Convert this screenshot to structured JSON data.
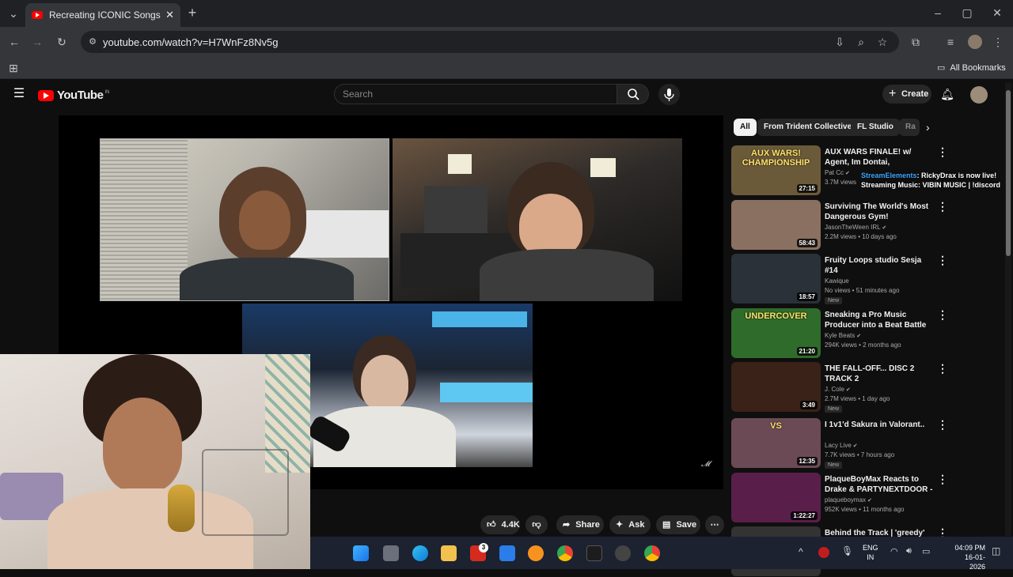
{
  "browser": {
    "tab_title": "Recreating ICONIC Songs With",
    "url": "youtube.com/watch?v=H7WnFz8Nv5g",
    "bookmarks_label": "All Bookmarks"
  },
  "youtube": {
    "logo_text": "YouTube",
    "country_code": "IN",
    "search_placeholder": "Search",
    "create_label": "Create"
  },
  "actions": {
    "likes": "4.4K",
    "share_label": "Share",
    "ask_label": "Ask",
    "save_label": "Save"
  },
  "chips": [
    "All",
    "From Trident Collective",
    "FL Studio",
    "Ra"
  ],
  "overlay_text": {
    "line1_name": "StreamElements",
    "line1_rest": ": RickyDrax is now live!",
    "line2": "Streaming Music: VIBIN MUSIC | !discord"
  },
  "videos": [
    {
      "title": "AUX WARS FINALE! w/ Agent, Im Dontai, Plaqueboymax, ...",
      "channel": "Pat Cc",
      "verified": true,
      "meta": "3.7M views",
      "duration": "27:15",
      "badge": "",
      "thumb_color": "#6b5a3a",
      "thumb_text": "AUX WARS! CHAMPIONSHIP"
    },
    {
      "title": "Surviving The World's Most Dangerous Gym!",
      "channel": "JasonTheWeen IRL",
      "verified": true,
      "meta": "2.2M views • 10 days ago",
      "duration": "58:43",
      "badge": "",
      "thumb_color": "#8a7060",
      "thumb_text": ""
    },
    {
      "title": "Fruity Loops studio Sesja #14",
      "channel": "Kawique",
      "verified": false,
      "meta": "No views • 51 minutes ago",
      "duration": "18:57",
      "badge": "New",
      "thumb_color": "#2a3138",
      "thumb_text": ""
    },
    {
      "title": "Sneaking a Pro Music Producer into a Beat Battle *discord*",
      "channel": "Kyle Beats",
      "verified": true,
      "meta": "294K views • 2 months ago",
      "duration": "21:20",
      "badge": "",
      "thumb_color": "#2f6b2a",
      "thumb_text": "UNDERCOVER"
    },
    {
      "title": "THE FALL-OFF... DISC 2 TRACK 2",
      "channel": "J. Cole",
      "verified": true,
      "meta": "2.7M views • 1 day ago",
      "duration": "3:49",
      "badge": "New",
      "thumb_color": "#3a2218",
      "thumb_text": ""
    },
    {
      "title": "I 1v1'd Sakura in Valorant..",
      "channel": "Lacy Live",
      "verified": true,
      "meta": "7.7K views • 7 hours ago",
      "duration": "12:35",
      "badge": "New",
      "thumb_color": "#6b4a56",
      "thumb_text": "VS"
    },
    {
      "title": "PlaqueBoyMax Reacts to Drake & PARTYNEXTDOOR - $OME ...",
      "channel": "plaqueboymax",
      "verified": true,
      "meta": "952K views • 11 months ago",
      "duration": "1:22:27",
      "badge": "",
      "thumb_color": "#5a1e4a",
      "thumb_text": ""
    },
    {
      "title": "Behind the Track | 'greedy' by",
      "channel": "",
      "verified": false,
      "meta": "",
      "duration": "",
      "badge": "",
      "thumb_color": "#333333",
      "thumb_text": ""
    }
  ],
  "taskbar": {
    "lang_line1": "ENG",
    "lang_line2": "IN",
    "time": "04:09 PM",
    "date": "16-01-2026",
    "notif_count": "3"
  }
}
